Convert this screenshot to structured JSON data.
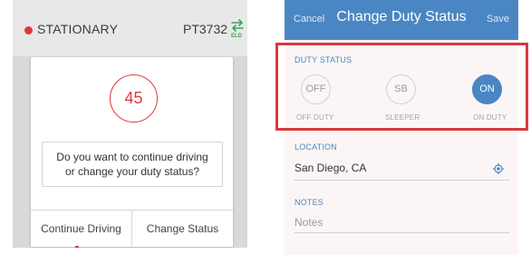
{
  "left_screen": {
    "status_text": "STATIONARY",
    "vehicle_id": "PT3732",
    "eld_label": "ELD",
    "modal": {
      "countdown": "45",
      "question": "Do you want to continue driving or change your duty status?",
      "continue_label": "Continue Driving",
      "change_label": "Change Status"
    }
  },
  "right_screen": {
    "header": {
      "cancel_label": "Cancel",
      "title": "Change Duty Status",
      "save_label": "Save"
    },
    "duty_status": {
      "section_label": "DUTY STATUS",
      "options": [
        {
          "code": "OFF",
          "label": "OFF DUTY",
          "selected": false
        },
        {
          "code": "SB",
          "label": "SLEEPER",
          "selected": false
        },
        {
          "code": "ON",
          "label": "ON DUTY",
          "selected": true
        }
      ]
    },
    "location": {
      "label": "LOCATION",
      "value": "San Diego, CA"
    },
    "notes": {
      "label": "NOTES",
      "placeholder": "Notes"
    }
  },
  "colors": {
    "status_red": "#e0393e",
    "eld_green": "#3aa55a",
    "header_blue": "#4a86c4",
    "highlight_red": "#d9393e"
  },
  "icons": {
    "status": "status-dot-icon",
    "eld": "eld-transfer-icon",
    "location": "gps-target-icon"
  }
}
